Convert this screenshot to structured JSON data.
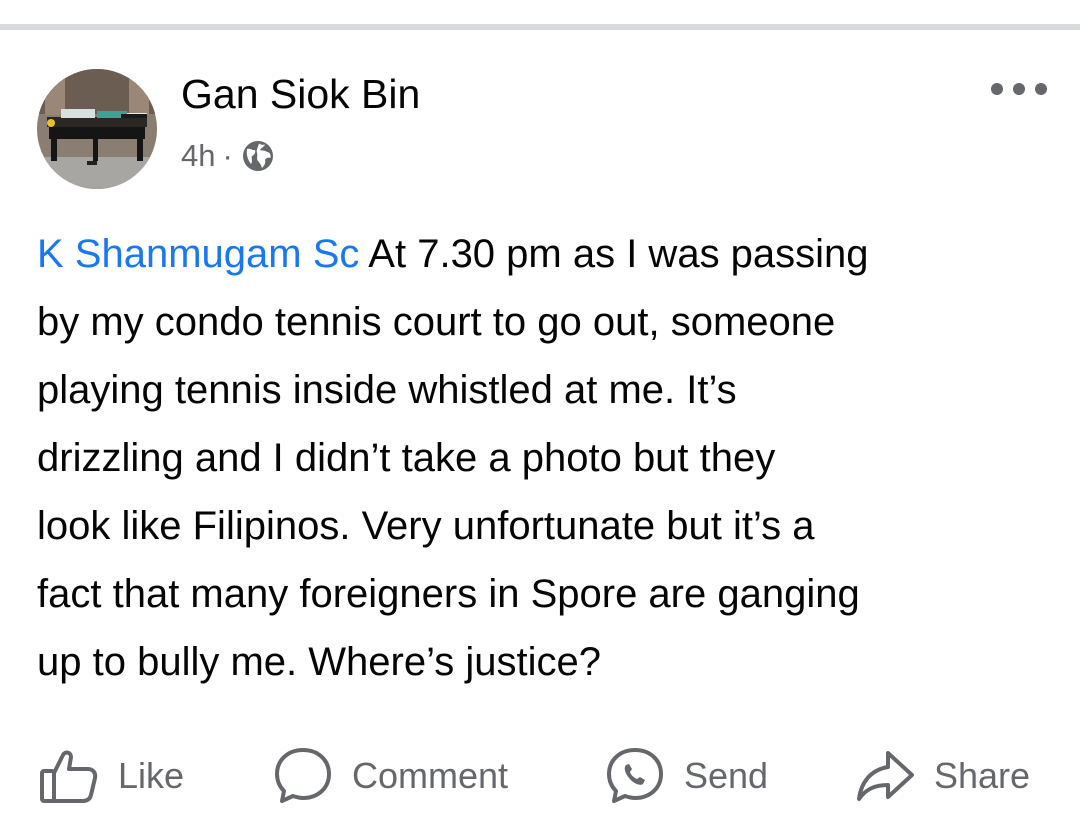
{
  "post": {
    "author": "Gan Siok Bin",
    "time": "4h",
    "separator": "·",
    "privacy_icon": "globe-icon",
    "more_icon": "more-horizontal-icon",
    "mention": "K Shanmugam Sc",
    "text_lines": [
      " At 7.30 pm as I was passing",
      "by my condo tennis court to go out, someone",
      "playing tennis inside whistled at me. It’s",
      "drizzling and I didn’t take a photo but they",
      "look like Filipinos. Very unfortunate but it’s a",
      "fact that many foreigners in Spore are ganging",
      "up to bully me. Where’s justice?"
    ]
  },
  "actions": {
    "like": "Like",
    "comment": "Comment",
    "send": "Send",
    "share": "Share"
  },
  "colors": {
    "mention": "#1877f2",
    "text": "#050505",
    "secondary": "#65676b",
    "divider": "#d7d9dc"
  }
}
